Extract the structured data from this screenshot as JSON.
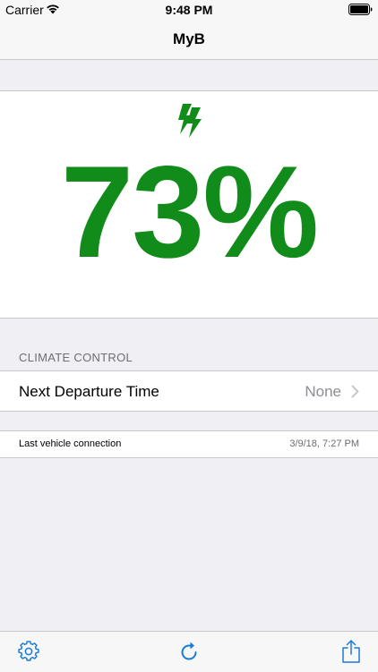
{
  "status_bar": {
    "carrier": "Carrier",
    "time": "9:48 PM"
  },
  "nav": {
    "title": "MyB"
  },
  "battery_panel": {
    "charge_percent": "73%",
    "accent_color": "#118b1a",
    "icon": "lightning-bolt-icon"
  },
  "climate": {
    "section_header": "CLIMATE CONTROL",
    "departure_label": "Next Departure Time",
    "departure_value": "None"
  },
  "connection": {
    "label": "Last vehicle connection",
    "value": "3/9/18, 7:27 PM"
  },
  "toolbar": {
    "icons": [
      "gear-icon",
      "refresh-icon",
      "share-icon"
    ],
    "tint_color": "#1a7bd8"
  }
}
